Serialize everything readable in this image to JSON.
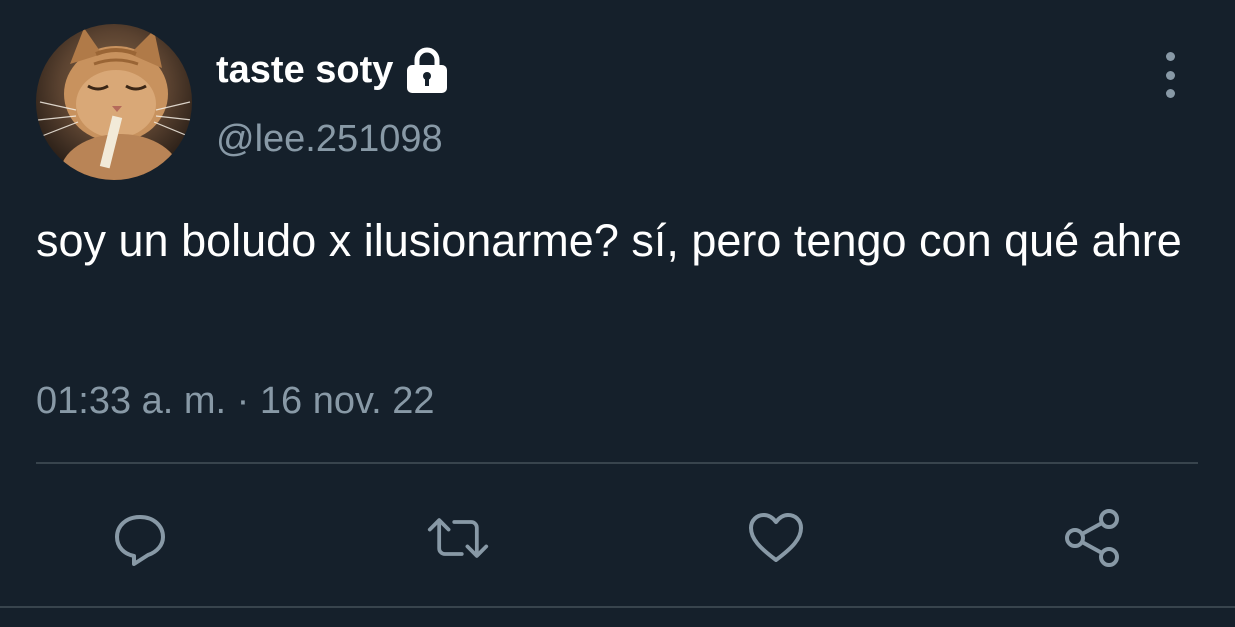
{
  "user": {
    "display_name": "taste soty",
    "handle": "@lee.251098",
    "protected_icon": "lock-icon",
    "avatar": "cat-avatar"
  },
  "tweet": {
    "text": "soy un boludo x ilusionarme? sí, pero tengo con qué ahre",
    "timestamp": "01:33 a. m. · 16 nov. 22"
  },
  "actions": [
    {
      "name": "reply",
      "icon": "reply-icon"
    },
    {
      "name": "retweet",
      "icon": "retweet-icon"
    },
    {
      "name": "like",
      "icon": "heart-icon"
    },
    {
      "name": "share",
      "icon": "share-icon"
    }
  ],
  "menu": {
    "icon": "more-vertical-icon"
  },
  "colors": {
    "background": "#15202b",
    "primary_text": "#ffffff",
    "secondary_text": "#8899a6",
    "divider": "#38444d"
  }
}
